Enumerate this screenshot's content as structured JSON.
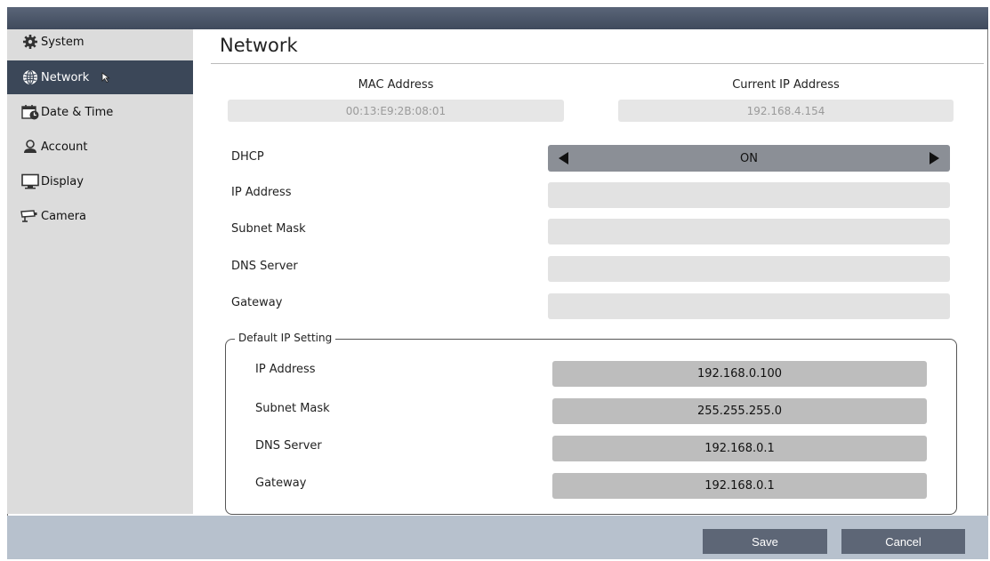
{
  "sidebar": {
    "items": [
      {
        "label": "System",
        "icon": "gear-icon"
      },
      {
        "label": "Network",
        "icon": "globe-icon"
      },
      {
        "label": "Date & Time",
        "icon": "calendar-clock-icon"
      },
      {
        "label": "Account",
        "icon": "user-icon"
      },
      {
        "label": "Display",
        "icon": "monitor-icon"
      },
      {
        "label": "Camera",
        "icon": "camera-icon"
      }
    ],
    "active_index": 1
  },
  "page": {
    "title": "Network"
  },
  "info": {
    "mac_label": "MAC Address",
    "mac_value": "00:13:E9:2B:08:01",
    "ip_label": "Current IP Address",
    "ip_value": "192.168.4.154"
  },
  "form": {
    "dhcp_label": "DHCP",
    "dhcp_value": "ON",
    "ip_label": "IP Address",
    "ip_value": "",
    "subnet_label": "Subnet Mask",
    "subnet_value": "",
    "dns_label": "DNS Server",
    "dns_value": "",
    "gateway_label": "Gateway",
    "gateway_value": ""
  },
  "default_ip": {
    "title": "Default IP Setting",
    "ip_label": "IP Address",
    "ip_value": "192.168.0.100",
    "subnet_label": "Subnet Mask",
    "subnet_value": "255.255.255.0",
    "dns_label": "DNS Server",
    "dns_value": "192.168.0.1",
    "gateway_label": "Gateway",
    "gateway_value": "192.168.0.1"
  },
  "footer": {
    "save_label": "Save",
    "cancel_label": "Cancel"
  },
  "colors": {
    "active_bg": "#3b4758",
    "topbar": "#4a5568",
    "footer": "#b7c1cd",
    "button": "#5d6676"
  }
}
